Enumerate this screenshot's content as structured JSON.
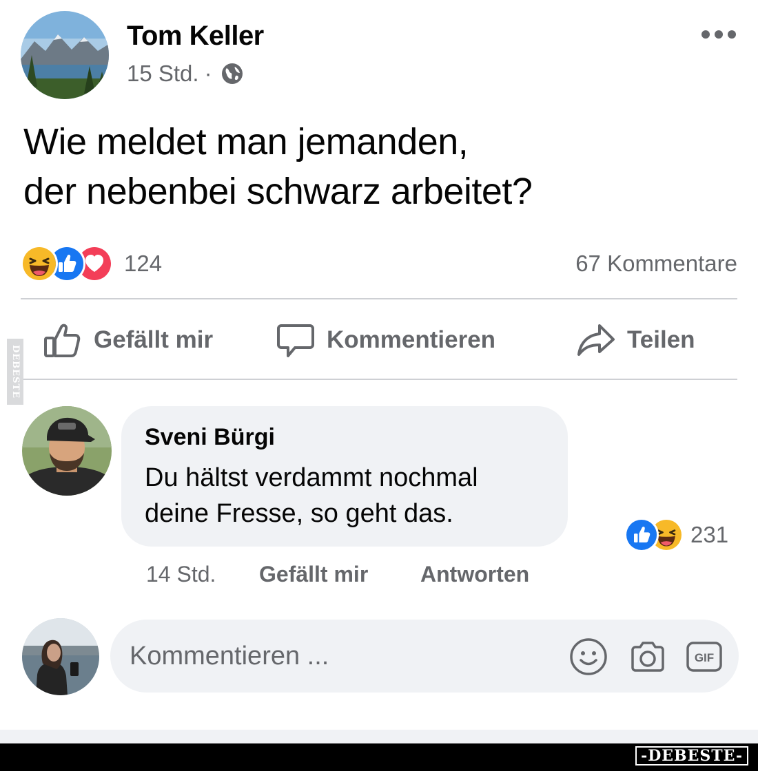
{
  "post": {
    "author": "Tom Keller",
    "time": "15 Std.",
    "separator": "·",
    "text_line1": "Wie meldet man jemanden,",
    "text_line2": "der nebenbei schwarz arbeitet?",
    "reaction_icons": [
      "haha-icon",
      "like-icon",
      "love-icon"
    ],
    "reaction_count": "124",
    "comment_count": "67 Kommentare"
  },
  "actions": {
    "like": "Gefällt mir",
    "comment": "Kommentieren",
    "share": "Teilen"
  },
  "comment": {
    "name": "Sveni Bürgi",
    "line1": "Du hältst verdammt nochmal",
    "line2": "deine Fresse, so geht das.",
    "time": "14 Std.",
    "like": "Gefällt mir",
    "reply": "Antworten",
    "reaction_icons": [
      "like-icon",
      "haha-icon"
    ],
    "reaction_count": "231"
  },
  "composer": {
    "placeholder": "Kommentieren ...",
    "icons": [
      "emoji-icon",
      "camera-icon",
      "gif-icon"
    ]
  },
  "watermark": {
    "side": "DEBESTE",
    "bottom": "-DEBESTE-"
  },
  "colors": {
    "secondary_text": "#65676b",
    "like_blue": "#1877f2",
    "love_red": "#f33e58",
    "haha_yellow": "#f7b928"
  }
}
